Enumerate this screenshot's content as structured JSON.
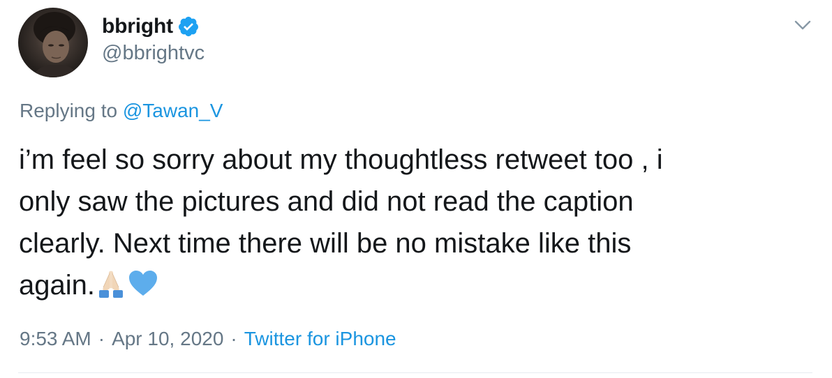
{
  "tweet": {
    "display_name": "bbright",
    "handle": "@bbrightvc",
    "verified": true,
    "replying_prefix": "Replying to ",
    "replying_to": "@Tawan_V",
    "text_lines": [
      "i’m feel so sorry about my thoughtless retweet too , i",
      "only saw the pictures and did not read the caption",
      "clearly. Next time there will be no mistake like this",
      "again."
    ],
    "emojis": [
      "folded-hands-icon",
      "blue-heart-icon"
    ],
    "time": "9:53 AM",
    "separator": "·",
    "date": "Apr 10, 2020",
    "source": "Twitter for iPhone"
  },
  "colors": {
    "text": "#14171a",
    "secondary": "#657786",
    "link": "#1b95e0",
    "verified": "#1da1f2",
    "heart": "#5dadec"
  }
}
